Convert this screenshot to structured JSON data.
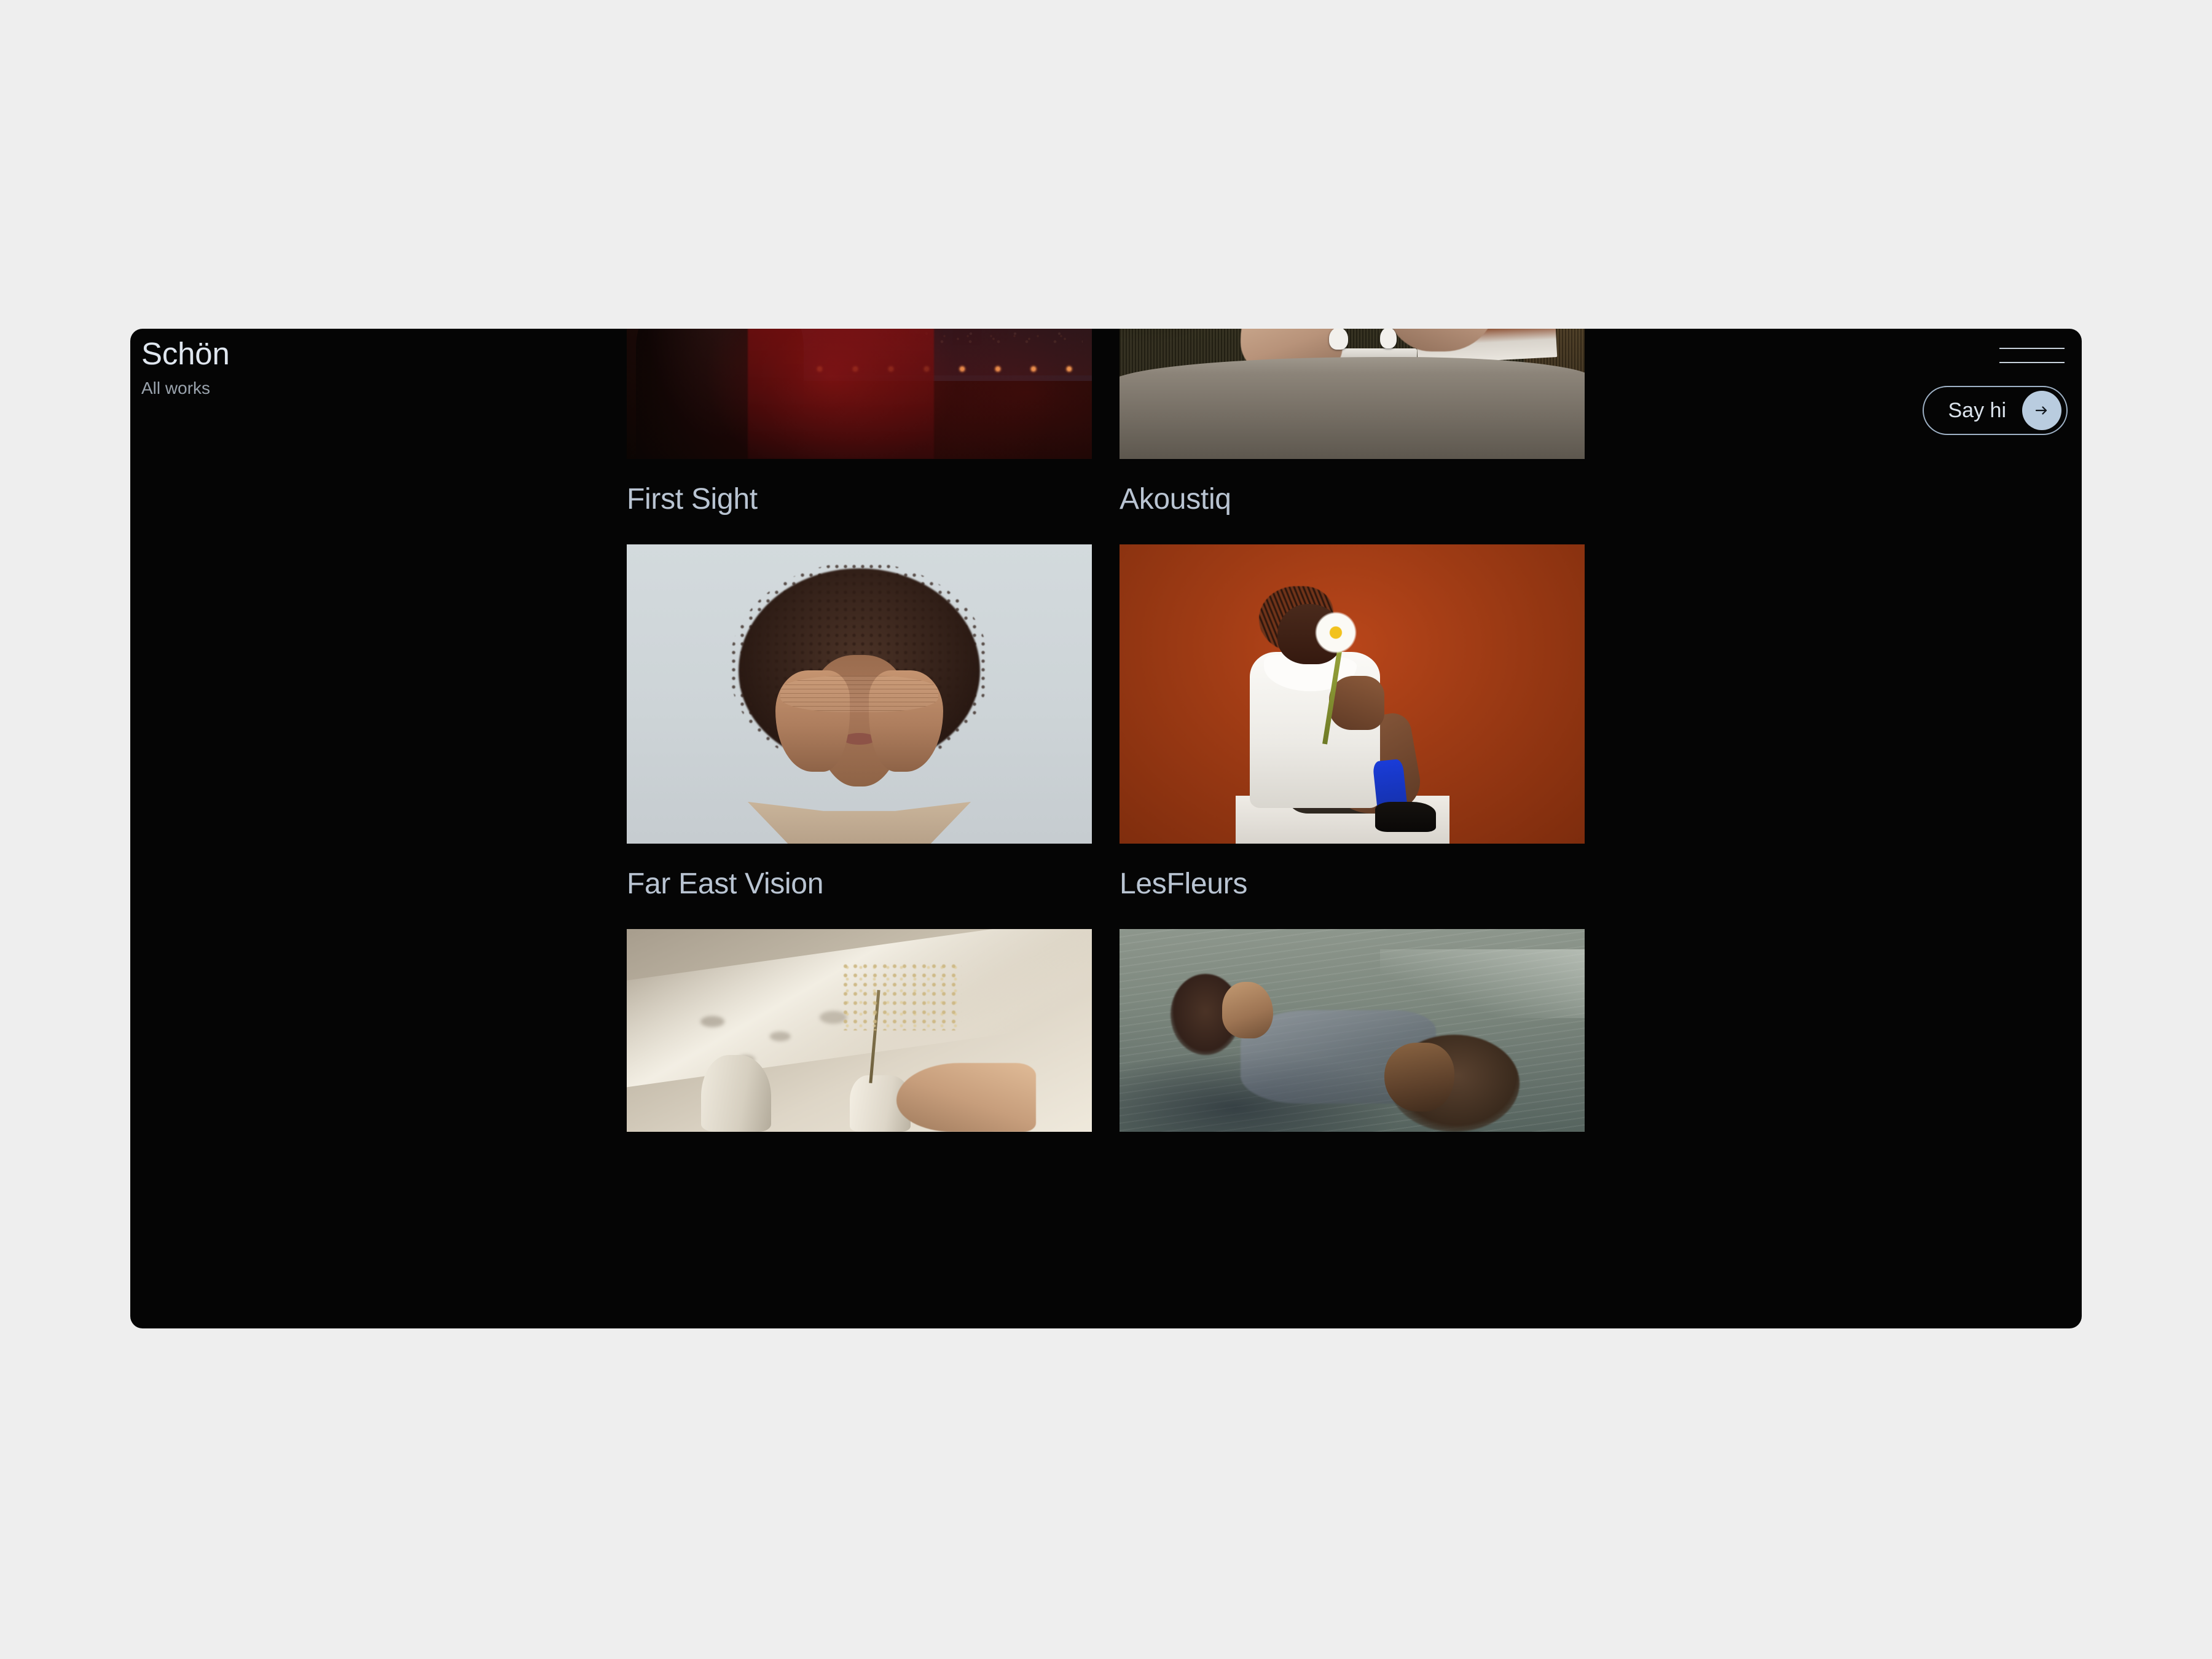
{
  "page": {
    "background_color": "#eeeeee",
    "panel_color": "#050505"
  },
  "brand": {
    "title": "Schön",
    "subtitle": "All works"
  },
  "header": {
    "menu_icon": "hamburger-icon",
    "cta": {
      "label": "Say hi",
      "arrow_icon": "arrow-right-icon",
      "circle_color": "#b9ccdf",
      "border_color": "#9fb2c6"
    }
  },
  "works": [
    {
      "title": "First Sight",
      "thumb": "night-car-fireworks"
    },
    {
      "title": "Akoustiq",
      "thumb": "hands-earbuds-table"
    },
    {
      "title": "Far East Vision",
      "thumb": "portrait-hands-over-eyes"
    },
    {
      "title": "LesFleurs",
      "thumb": "orange-backdrop-model-flower"
    },
    {
      "title": "",
      "thumb": "still-life-vases-dried-flowers"
    },
    {
      "title": "",
      "thumb": "two-figures-floating-water"
    }
  ],
  "colors": {
    "caption_text": "#b9c4d2",
    "title_text": "#dfe6ef",
    "subtitle_text": "#9aa3ad"
  }
}
